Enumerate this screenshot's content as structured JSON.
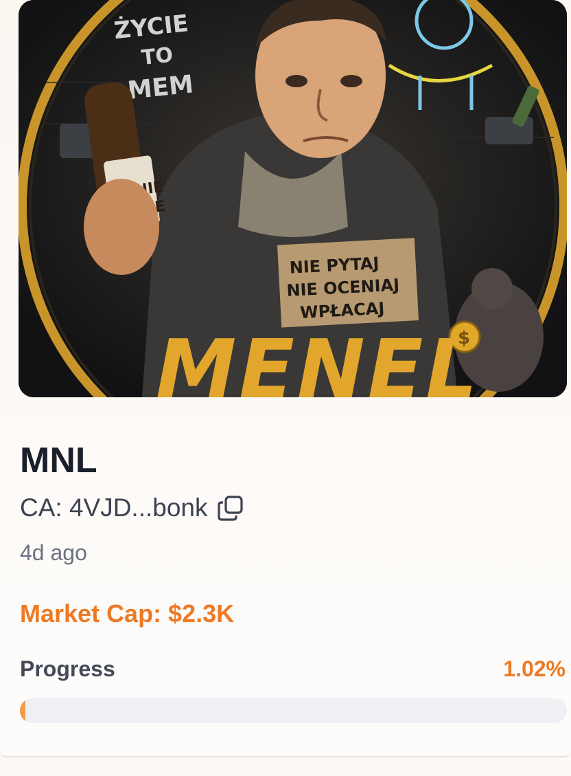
{
  "token": {
    "image": {
      "wall_text": "ŻYCIE TO MEM",
      "bottle_label": "TANIE ŻYCIE",
      "sign_text": "NIE PYTAJ NIE OCENIAJ WPŁACAJ",
      "logo_text": "MENEL"
    },
    "ticker": "MNL",
    "ca": "CA: 4VJD...bonk",
    "copy_icon": "copy-icon",
    "age": "4d ago",
    "market_cap": "Market Cap: $2.3K",
    "progress_label": "Progress",
    "progress_text": "1.02%",
    "progress_value": 1.02
  },
  "colors": {
    "accent": "#ed7a24",
    "progress_fill": "#f39a4a",
    "title": "#1b1f2b"
  }
}
